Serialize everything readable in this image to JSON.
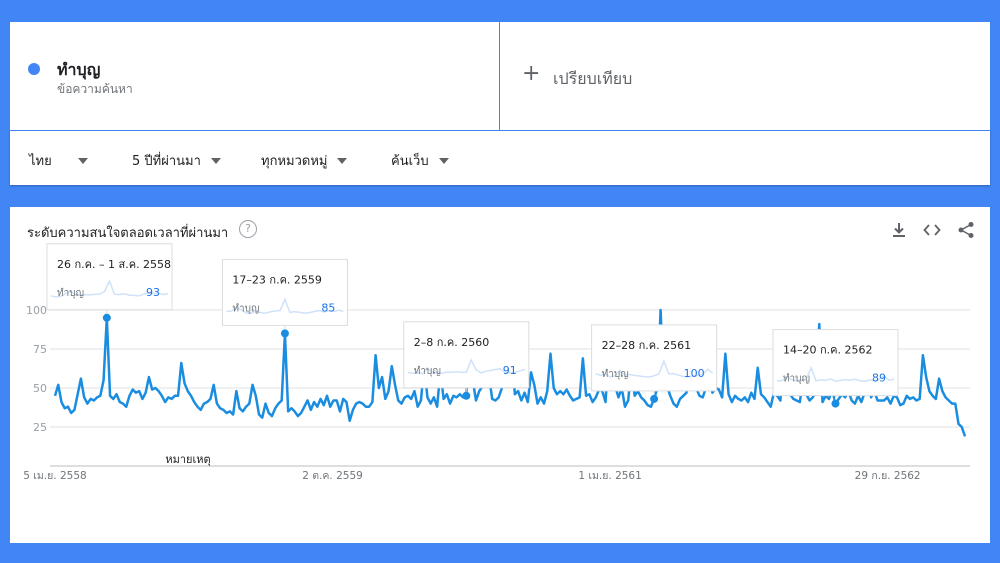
{
  "term": {
    "name": "ทำบุญ",
    "subtitle": "ข้อความค้นหา"
  },
  "compare": {
    "label": "เปรียบเทียบ"
  },
  "filters": {
    "region": "ไทย",
    "period": "5 ปีที่ผ่านมา",
    "category": "ทุกหมวดหมู่",
    "source": "ค้นเว็บ"
  },
  "chart_section": {
    "title": "ระดับความสนใจตลอดเวลาที่ผ่านมา",
    "help": "?"
  },
  "colors": {
    "line": "#1a8de0",
    "accent": "#4285f4",
    "background": "#4285f4"
  },
  "icons": [
    "download-icon",
    "embed-icon",
    "share-icon"
  ],
  "chart_data": {
    "type": "line",
    "title": "",
    "xlabel": "",
    "ylabel": "",
    "ylim": [
      0,
      100
    ],
    "yticks": [
      25,
      50,
      75,
      100
    ],
    "grid": true,
    "legend": "none",
    "x_tick_labels": [
      "5 เม.ย. 2558",
      "2 ต.ค. 2559",
      "1 เม.ย. 2561",
      "29 ก.ย. 2562"
    ],
    "series": [
      {
        "name": "ทำบุญ",
        "values": [
          45,
          52,
          41,
          37,
          38,
          34,
          36,
          46,
          56,
          44,
          40,
          43,
          42,
          44,
          45,
          55,
          95,
          45,
          43,
          46,
          41,
          40,
          38,
          45,
          49,
          47,
          48,
          43,
          47,
          57,
          49,
          50,
          48,
          45,
          41,
          44,
          43,
          45,
          45,
          66,
          53,
          48,
          45,
          41,
          38,
          36,
          40,
          41,
          43,
          52,
          40,
          37,
          36,
          34,
          35,
          33,
          48,
          37,
          35,
          38,
          40,
          52,
          45,
          33,
          31,
          40,
          34,
          32,
          37,
          40,
          42,
          85,
          35,
          37,
          35,
          32,
          34,
          38,
          42,
          36,
          41,
          38,
          43,
          39,
          45,
          38,
          42,
          42,
          35,
          43,
          41,
          29,
          36,
          40,
          41,
          40,
          38,
          38,
          41,
          71,
          50,
          57,
          43,
          48,
          64,
          52,
          42,
          40,
          44,
          45,
          43,
          48,
          38,
          42,
          65,
          44,
          40,
          44,
          38,
          61,
          43,
          46,
          40,
          45,
          44,
          46,
          44,
          45,
          91,
          55,
          42,
          48,
          51,
          55,
          58,
          43,
          42,
          44,
          50,
          55,
          58,
          74,
          46,
          48,
          42,
          47,
          41,
          60,
          52,
          40,
          44,
          40,
          48,
          72,
          50,
          46,
          48,
          46,
          49,
          45,
          42,
          43,
          44,
          69,
          45,
          46,
          41,
          44,
          49,
          48,
          41,
          73,
          55,
          51,
          44,
          50,
          38,
          42,
          64,
          45,
          48,
          44,
          42,
          39,
          38,
          43,
          50,
          100,
          51,
          51,
          45,
          40,
          38,
          43,
          45,
          47,
          68,
          53,
          50,
          45,
          44,
          50,
          62,
          47,
          50,
          49,
          44,
          72,
          46,
          41,
          45,
          43,
          42,
          44,
          41,
          47,
          43,
          63,
          46,
          44,
          41,
          38,
          47,
          45,
          42,
          68,
          55,
          46,
          43,
          42,
          41,
          56,
          46,
          42,
          44,
          48,
          91,
          41,
          45,
          43,
          49,
          40,
          43,
          46,
          44,
          48,
          42,
          40,
          45,
          41,
          47,
          60,
          44,
          48,
          42,
          42,
          42,
          44,
          40,
          45,
          44,
          39,
          40,
          45,
          43,
          44,
          42,
          43,
          71,
          57,
          48,
          45,
          43,
          56,
          48,
          44,
          42,
          40,
          40,
          27,
          25,
          19
        ]
      }
    ],
    "peaks": [
      {
        "index": 16,
        "label": "26 ก.ค. – 1 ส.ค. 2558",
        "term": "ทำบุญ",
        "value": 93
      },
      {
        "index": 71,
        "label": "17–23 ก.ค. 2559",
        "term": "ทำบุญ",
        "value": 85
      },
      {
        "index": 127,
        "label": "2–8 ก.ค. 2560",
        "term": "ทำบุญ",
        "value": 91
      },
      {
        "index": 185,
        "label": "22–28 ก.ค. 2561",
        "term": "ทำบุญ",
        "value": 100
      },
      {
        "index": 241,
        "label": "14–20 ก.ค. 2562",
        "term": "ทำบุญ",
        "value": 89
      }
    ],
    "annotation": "หมายเหตุ"
  }
}
